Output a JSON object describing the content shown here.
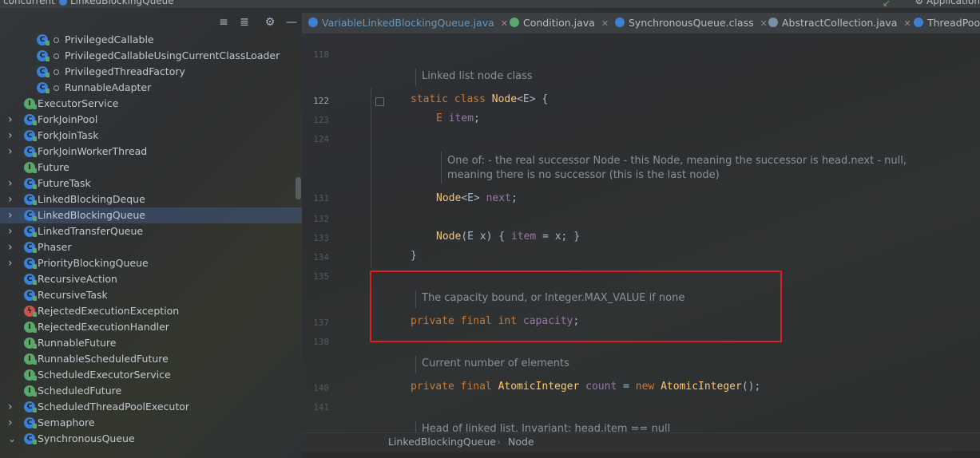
{
  "topbar": {
    "breadcrumb": [
      "concurrent",
      "LinkedBlockingQueue"
    ],
    "run_config": "Application"
  },
  "project_panel": {
    "toolbar": [
      "expand-all-icon",
      "collapse-all-icon",
      "settings-gear-icon",
      "hide-icon"
    ],
    "items": [
      {
        "label": "PrivilegedCallable",
        "kind": "class",
        "indent": 2,
        "expandable": false
      },
      {
        "label": "PrivilegedCallableUsingCurrentClassLoader",
        "kind": "class",
        "indent": 2,
        "expandable": false
      },
      {
        "label": "PrivilegedThreadFactory",
        "kind": "class",
        "indent": 2,
        "expandable": false
      },
      {
        "label": "RunnableAdapter",
        "kind": "class",
        "indent": 2,
        "expandable": false
      },
      {
        "label": "ExecutorService",
        "kind": "interface",
        "indent": 1,
        "expandable": false
      },
      {
        "label": "ForkJoinPool",
        "kind": "class",
        "indent": 1,
        "expandable": true
      },
      {
        "label": "ForkJoinTask",
        "kind": "class",
        "indent": 1,
        "expandable": true
      },
      {
        "label": "ForkJoinWorkerThread",
        "kind": "class",
        "indent": 1,
        "expandable": true
      },
      {
        "label": "Future",
        "kind": "interface",
        "indent": 1,
        "expandable": false
      },
      {
        "label": "FutureTask",
        "kind": "class",
        "indent": 1,
        "expandable": true
      },
      {
        "label": "LinkedBlockingDeque",
        "kind": "class",
        "indent": 1,
        "expandable": true
      },
      {
        "label": "LinkedBlockingQueue",
        "kind": "class",
        "indent": 1,
        "expandable": true,
        "selected": true
      },
      {
        "label": "LinkedTransferQueue",
        "kind": "class",
        "indent": 1,
        "expandable": true
      },
      {
        "label": "Phaser",
        "kind": "class",
        "indent": 1,
        "expandable": true
      },
      {
        "label": "PriorityBlockingQueue",
        "kind": "class",
        "indent": 1,
        "expandable": true
      },
      {
        "label": "RecursiveAction",
        "kind": "class",
        "indent": 1,
        "expandable": false
      },
      {
        "label": "RecursiveTask",
        "kind": "class",
        "indent": 1,
        "expandable": false
      },
      {
        "label": "RejectedExecutionException",
        "kind": "exception",
        "indent": 1,
        "expandable": false
      },
      {
        "label": "RejectedExecutionHandler",
        "kind": "interface",
        "indent": 1,
        "expandable": false
      },
      {
        "label": "RunnableFuture",
        "kind": "interface",
        "indent": 1,
        "expandable": false
      },
      {
        "label": "RunnableScheduledFuture",
        "kind": "interface",
        "indent": 1,
        "expandable": false
      },
      {
        "label": "ScheduledExecutorService",
        "kind": "interface",
        "indent": 1,
        "expandable": false
      },
      {
        "label": "ScheduledFuture",
        "kind": "interface",
        "indent": 1,
        "expandable": false
      },
      {
        "label": "ScheduledThreadPoolExecutor",
        "kind": "class",
        "indent": 1,
        "expandable": true
      },
      {
        "label": "Semaphore",
        "kind": "class",
        "indent": 1,
        "expandable": true
      },
      {
        "label": "SynchronousQueue",
        "kind": "class",
        "indent": 1,
        "expandable": true,
        "expanded": true
      }
    ]
  },
  "editor": {
    "tabs": [
      {
        "label": "VariableLinkedBlockingQueue.java",
        "icon": "class-icon",
        "active": true
      },
      {
        "label": "Condition.java",
        "icon": "interface-icon",
        "active": false
      },
      {
        "label": "SynchronousQueue.class",
        "icon": "class-icon",
        "active": false
      },
      {
        "label": "AbstractCollection.java",
        "icon": "abstract-class-icon",
        "active": false
      },
      {
        "label": "ThreadPoo",
        "icon": "class-icon",
        "active": false
      }
    ],
    "line_numbers": [
      "118",
      "122",
      "123",
      "124",
      "131",
      "132",
      "133",
      "134",
      "135",
      "137",
      "138",
      "140",
      "141"
    ],
    "doc_node": "Linked list node class",
    "code_node_decl": {
      "kw": "static class",
      "type": "Node",
      "generic": "<E>",
      "brace": " {"
    },
    "code_item": {
      "type": "E",
      "field": "item",
      "end": ";"
    },
    "doc_next_1": "One of: - the real successor Node - this Node, meaning the successor is head.next - null,",
    "doc_next_2": "meaning there is no successor (this is the last node)",
    "code_next": {
      "type": "Node",
      "generic": "<E>",
      "field": "next",
      "end": ";"
    },
    "code_ctor": {
      "type": "Node",
      "params": "(E x) { ",
      "field": "item",
      "rest": " = x; }"
    },
    "code_close": "}",
    "doc_capacity": "The capacity bound, or Integer.MAX_VALUE if none",
    "code_capacity": {
      "kw": "private final int",
      "field": "capacity",
      "end": ";"
    },
    "doc_count": "Current number of elements",
    "code_count": {
      "kw": "private final",
      "type": "AtomicInteger",
      "field": "count",
      "eq": " = ",
      "kw2": "new",
      "type2": "AtomicInteger",
      "end": "();"
    },
    "doc_head": "Head of linked list. Invariant: head.item == null",
    "breadcrumb": [
      "LinkedBlockingQueue",
      "Node"
    ]
  }
}
